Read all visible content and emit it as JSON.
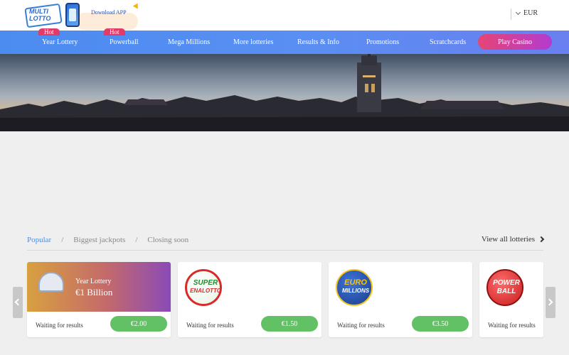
{
  "header": {
    "logo_line1": "MULTI",
    "logo_line2": "LOTTO",
    "download_app": "Download APP",
    "currency": "EUR"
  },
  "nav": {
    "hot_badge": "Hot",
    "items": [
      "Year Lottery",
      "Powerball",
      "Mega Millions",
      "More lotteries",
      "Results & Info",
      "Promotions",
      "Scratchcards"
    ],
    "play_casino": "Play Casino"
  },
  "filter": {
    "tabs": [
      "Popular",
      "Biggest jackpots",
      "Closing soon"
    ],
    "separator": "/",
    "view_all": "View all lotteries"
  },
  "cards": [
    {
      "name": "Year Lottery",
      "jackpot": "€1 Billion",
      "status": "Waiting for results",
      "price": "€2.00"
    },
    {
      "logo_line1": "SUPER",
      "logo_line2": "ENALOTTO",
      "status": "Waiting for results",
      "price": "€1.50"
    },
    {
      "logo_line1": "EURO",
      "logo_line2": "MILLIONS",
      "status": "Waiting for results",
      "price": "€3.50"
    },
    {
      "logo_line1": "POWER",
      "logo_line2": "BALL",
      "status": "Waiting for results"
    }
  ],
  "colors": {
    "nav_start": "#4c8cf0",
    "accent_pink": "#e23b6a",
    "price_green": "#62c164",
    "active_tab": "#4a8fe0"
  },
  "icons": [
    "chevron-down-icon",
    "chevron-right-icon",
    "carousel-left-icon",
    "carousel-right-icon",
    "phone-icon"
  ]
}
